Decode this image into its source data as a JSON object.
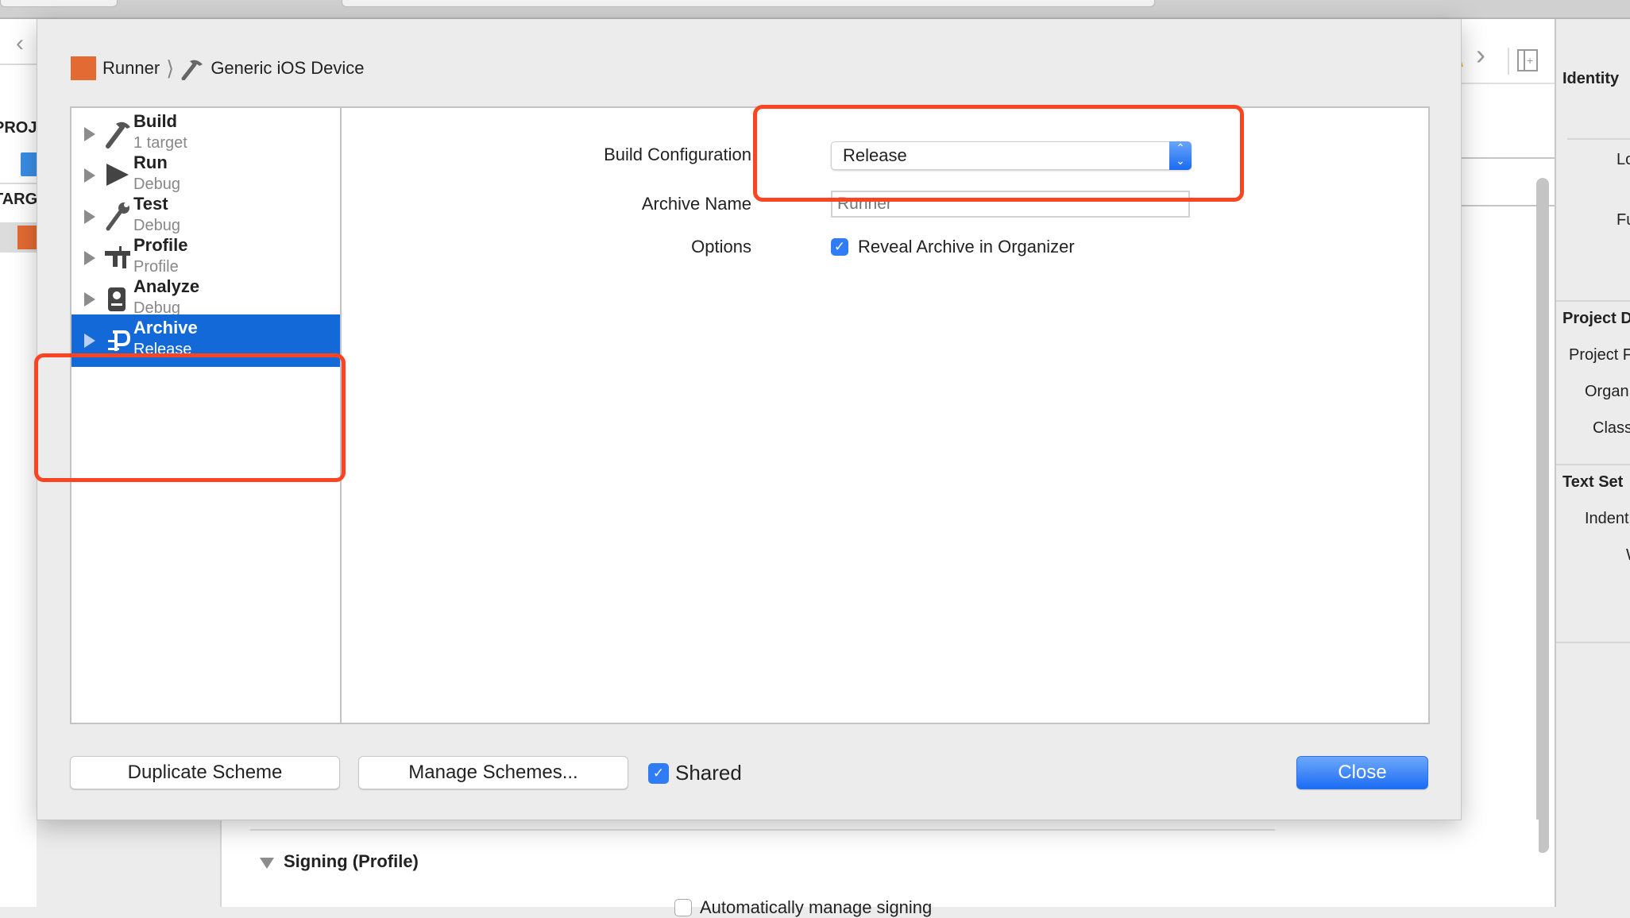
{
  "breadcrumb": {
    "scheme": "Runner",
    "destination": "Generic iOS Device"
  },
  "actions": [
    {
      "name": "Build",
      "detail": "1 target",
      "icon": "hammer-icon",
      "selected": false
    },
    {
      "name": "Run",
      "detail": "Debug",
      "icon": "play-icon",
      "selected": false
    },
    {
      "name": "Test",
      "detail": "Debug",
      "icon": "wrench-icon",
      "selected": false
    },
    {
      "name": "Profile",
      "detail": "Profile",
      "icon": "caliper-icon",
      "selected": false
    },
    {
      "name": "Analyze",
      "detail": "Debug",
      "icon": "analyze-icon",
      "selected": false
    },
    {
      "name": "Archive",
      "detail": "Release",
      "icon": "archive-clamp-icon",
      "selected": true
    }
  ],
  "form": {
    "build_configuration_label": "Build Configuration",
    "build_configuration_value": "Release",
    "archive_name_label": "Archive Name",
    "archive_name_placeholder": "Runner",
    "options_label": "Options",
    "reveal_archive_label": "Reveal Archive in Organizer",
    "reveal_archive_checked": true
  },
  "footer": {
    "duplicate_label": "Duplicate Scheme",
    "manage_label": "Manage Schemes...",
    "shared_label": "Shared",
    "shared_checked": true,
    "close_label": "Close"
  },
  "background": {
    "left_sidebar": {
      "project_header": "PROJ",
      "targets_header": "TARG"
    },
    "inspector": {
      "identity_header": "Identity",
      "location_label": "Lo",
      "fullpath_label": "Fu",
      "project_doc_header": "Project D",
      "project_format_label": "Project F",
      "organization_label": "Organ",
      "class_prefix_label": "Class",
      "text_settings_header": "Text Set",
      "indent_label": "Indent",
      "widths_label": "W"
    },
    "signing_section": "Signing (Profile)",
    "auto_signing_label": "Automatically manage signing"
  },
  "colors": {
    "accent": "#1369d8",
    "annotation": "#fc4322",
    "project_icon": "#e36a32"
  }
}
